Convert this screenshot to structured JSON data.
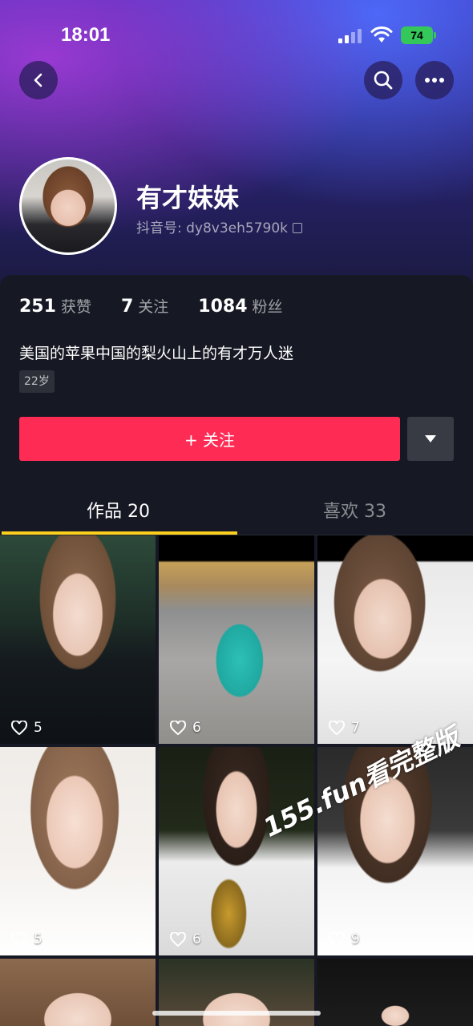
{
  "status_bar": {
    "time": "18:01",
    "battery": "74"
  },
  "profile": {
    "nickname": "有才妹妹",
    "douyin_id": "抖音号: dy8v3eh5790k",
    "stats": [
      {
        "value": "251",
        "label": "获赞"
      },
      {
        "value": "7",
        "label": "关注"
      },
      {
        "value": "1084",
        "label": "粉丝"
      }
    ],
    "bio": "美国的苹果中国的梨火山上的有才万人迷",
    "age_tag": "22岁"
  },
  "actions": {
    "follow_label": "+ 关注"
  },
  "tabs": [
    {
      "label": "作品 20",
      "active": true
    },
    {
      "label": "喜欢 33",
      "active": false
    }
  ],
  "videos": [
    {
      "likes": "5"
    },
    {
      "likes": "6"
    },
    {
      "likes": "7"
    },
    {
      "likes": "5"
    },
    {
      "likes": "6"
    },
    {
      "likes": "9"
    }
  ],
  "watermark": "155.fun看完整版",
  "colors": {
    "accent": "#fe2c55",
    "tab_indicator": "#facf1d",
    "background": "#161823"
  },
  "icons": [
    "back-icon",
    "search-icon",
    "more-icon",
    "copy-icon",
    "heart-icon",
    "chevron-down-icon"
  ]
}
